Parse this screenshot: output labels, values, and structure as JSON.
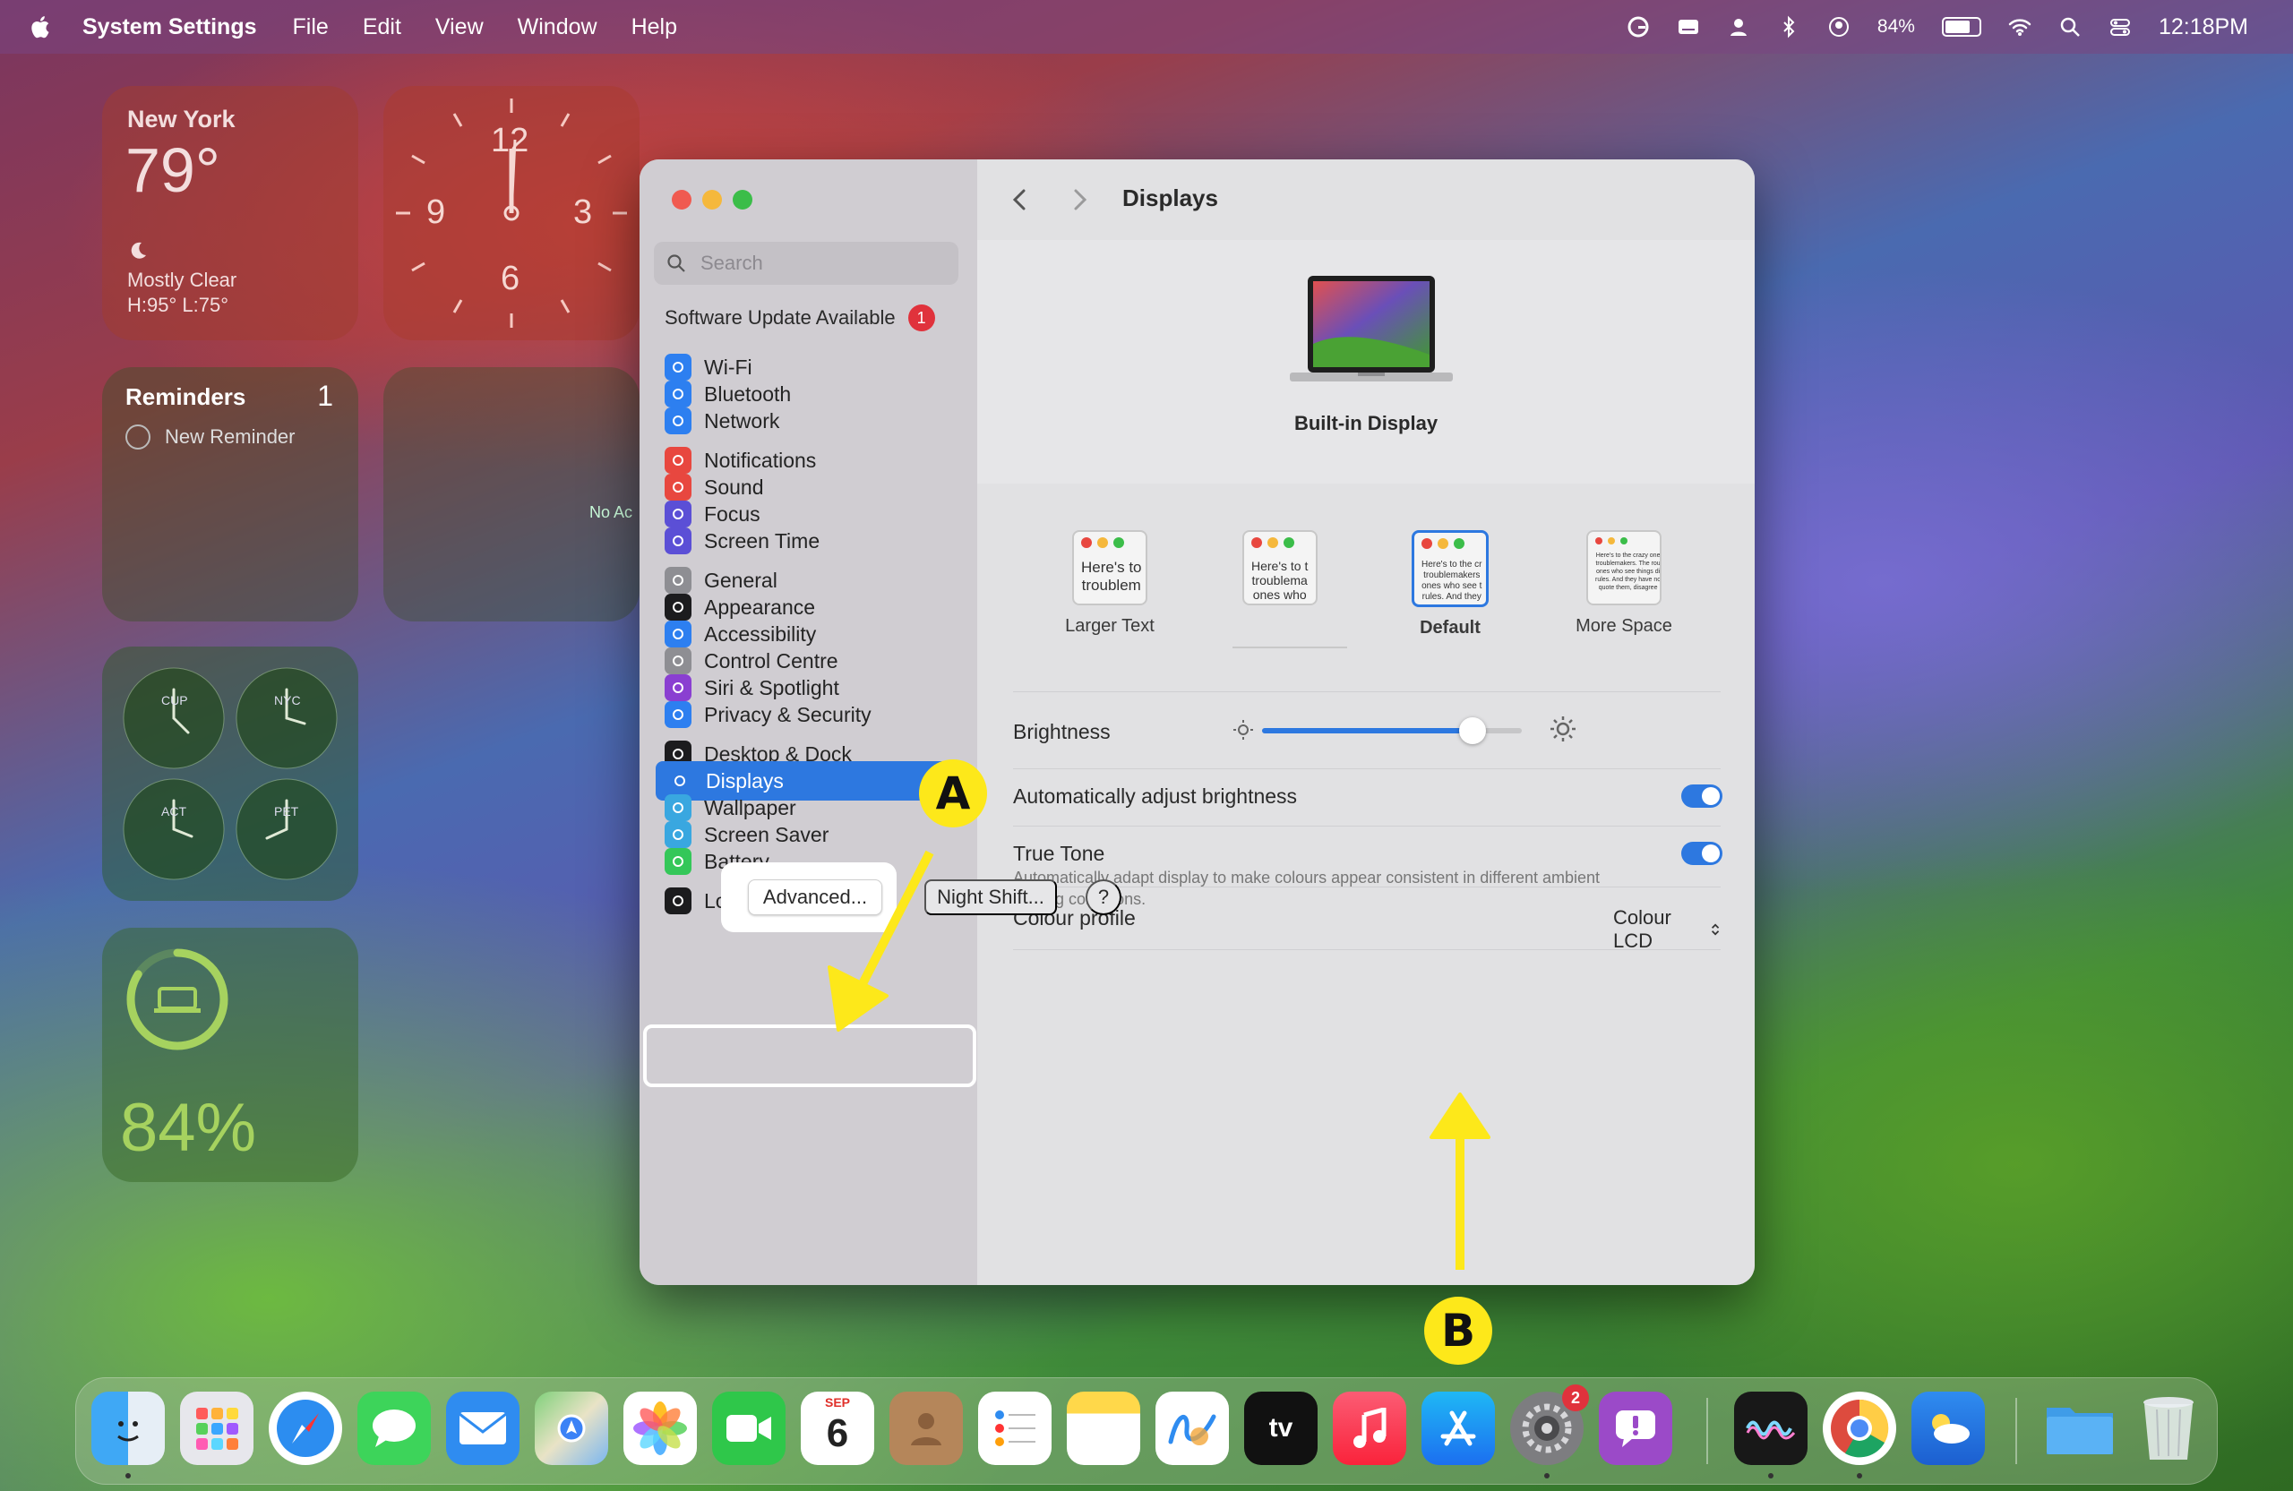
{
  "menubar": {
    "app_name": "System Settings",
    "menus": [
      "File",
      "Edit",
      "View",
      "Window",
      "Help"
    ],
    "battery_percent": "84%",
    "battery_level": 0.84,
    "time": "12:18PM"
  },
  "widgets": {
    "weather": {
      "city": "New York",
      "temp": "79°",
      "condition": "Mostly Clear",
      "high_low": "H:95° L:75°"
    },
    "clock": {
      "numbers": [
        "12",
        "3",
        "6",
        "9"
      ]
    },
    "reminders": {
      "title": "Reminders",
      "count": "1",
      "item": "New Reminder"
    },
    "blank": {
      "partial_text": "No Ac"
    },
    "world_clock": {
      "cities": [
        "CUP",
        "NYC",
        "ACT",
        "PET"
      ]
    },
    "battery": {
      "percent": "84%",
      "level": 0.84
    }
  },
  "window": {
    "search_placeholder": "Search",
    "update": {
      "label": "Software Update Available",
      "badge": "1"
    },
    "sidebar_items": [
      {
        "label": "Wi-Fi",
        "icon": "wifi-icon",
        "color": "#2d7ff0"
      },
      {
        "label": "Bluetooth",
        "icon": "bluetooth-icon",
        "color": "#2d7ff0"
      },
      {
        "label": "Network",
        "icon": "globe-icon",
        "color": "#2d7ff0"
      },
      {
        "label": "Notifications",
        "icon": "bell-icon",
        "color": "#e8473f"
      },
      {
        "label": "Sound",
        "icon": "speaker-icon",
        "color": "#e8473f"
      },
      {
        "label": "Focus",
        "icon": "moon-icon",
        "color": "#5b4fd6"
      },
      {
        "label": "Screen Time",
        "icon": "hourglass-icon",
        "color": "#5b4fd6"
      },
      {
        "label": "General",
        "icon": "gear-icon",
        "color": "#8e8e93"
      },
      {
        "label": "Appearance",
        "icon": "appearance-icon",
        "color": "#1c1c1e"
      },
      {
        "label": "Accessibility",
        "icon": "accessibility-icon",
        "color": "#2d7ff0"
      },
      {
        "label": "Control Centre",
        "icon": "control-centre-icon",
        "color": "#8e8e93"
      },
      {
        "label": "Siri & Spotlight",
        "icon": "siri-icon",
        "color": "#8a3fd1"
      },
      {
        "label": "Privacy & Security",
        "icon": "hand-icon",
        "color": "#2d7ff0"
      },
      {
        "label": "Desktop & Dock",
        "icon": "dock-icon",
        "color": "#1c1c1e"
      },
      {
        "label": "Displays",
        "icon": "sun-icon",
        "color": "#2d7ff0",
        "selected": true
      },
      {
        "label": "Wallpaper",
        "icon": "wallpaper-icon",
        "color": "#39a7e0"
      },
      {
        "label": "Screen Saver",
        "icon": "screensaver-icon",
        "color": "#39a7e0"
      },
      {
        "label": "Battery",
        "icon": "battery-icon",
        "color": "#34c759"
      },
      {
        "label": "Lock Screen",
        "icon": "lock-icon",
        "color": "#1c1c1e"
      }
    ],
    "content": {
      "title": "Displays",
      "display_name": "Built-in Display",
      "resolution_options": [
        {
          "label": "Larger Text",
          "preview": "Here's to\ntroublem"
        },
        {
          "label": "",
          "preview": "Here's to t\ntroublema\nones who"
        },
        {
          "label": "Default",
          "preview": "Here's to the cr\ntroublemakers\nones who see t\nrules. And they",
          "selected": true
        },
        {
          "label": "More Space",
          "preview": "Here's to the crazy one\ntroublemakers. The rou\nones who see things di\nrules. And they have no\nquote them, disagree"
        }
      ],
      "brightness": {
        "label": "Brightness",
        "level": 0.81
      },
      "auto_brightness": {
        "label": "Automatically adjust brightness",
        "on": true
      },
      "true_tone": {
        "label": "True Tone",
        "description": "Automatically adapt display to make colours appear consistent in different ambient lighting conditions.",
        "on": true
      },
      "colour_profile": {
        "label": "Colour profile",
        "value": "Colour LCD"
      },
      "buttons": {
        "advanced": "Advanced...",
        "night_shift": "Night Shift...",
        "help": "?"
      }
    }
  },
  "annotations": {
    "a": "A",
    "b": "B"
  },
  "dock": {
    "calendar": {
      "month": "SEP",
      "day": "6"
    },
    "settings_badge": "2",
    "apps": [
      "finder-icon",
      "launchpad-icon",
      "safari-icon",
      "messages-icon",
      "mail-icon",
      "maps-icon",
      "photos-icon",
      "facetime-icon",
      "calendar-icon",
      "contacts-icon",
      "reminders-icon",
      "notes-icon",
      "freeform-icon",
      "tv-icon",
      "music-icon",
      "app-store-icon",
      "system-settings-icon",
      "feedback-icon",
      "audio-app-icon",
      "chrome-icon",
      "weather-icon",
      "folder-icon",
      "trash-icon"
    ]
  }
}
